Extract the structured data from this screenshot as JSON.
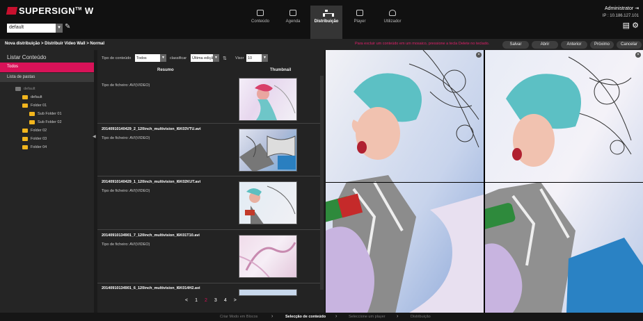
{
  "header": {
    "logo": "SUPERSIGN",
    "logo_tm": "TM",
    "logo_suffix": "W",
    "group_select": "default",
    "nav": [
      {
        "label": "Conteúdo",
        "icon": "content-icon"
      },
      {
        "label": "Agenda",
        "icon": "calendar-icon"
      },
      {
        "label": "Distribuição",
        "icon": "distribution-icon",
        "active": true
      },
      {
        "label": "Player",
        "icon": "player-icon"
      },
      {
        "label": "Utilizador",
        "icon": "user-icon"
      }
    ],
    "user": "Administrator",
    "ip": "IP : 10.186.127.101"
  },
  "toolbar": {
    "breadcrumb": "Nova distribuição > Distribuir Video Wall > Normal",
    "hint": "Para excluir um conteúdo em um mosaico, pressione a tecla Delete no teclado.",
    "buttons": [
      "Salvar",
      "Abrir",
      "Anterior",
      "Próximo",
      "Cancelar"
    ]
  },
  "sidebar": {
    "title": "Listar Conteúdo",
    "tab_all": "Todos",
    "tab_folders": "Lista de pastas",
    "tree": [
      {
        "label": "default",
        "level": 0,
        "root": true
      },
      {
        "label": "default",
        "level": 1
      },
      {
        "label": "Folder 01",
        "level": 1
      },
      {
        "label": "Sub Folder 01",
        "level": 2
      },
      {
        "label": "Sub Folder 02",
        "level": 2
      },
      {
        "label": "Folder 02",
        "level": 1
      },
      {
        "label": "Folder 03",
        "level": 1
      },
      {
        "label": "Folder 04",
        "level": 1
      }
    ]
  },
  "list": {
    "filter_type_label": "Tipo de conteúdo",
    "filter_type_value": "Todos",
    "sort_label": "classificar",
    "sort_value": "Última ediçã",
    "view_label": "Visor",
    "view_value": "10",
    "col_summary": "Resumo",
    "col_thumb": "Thumbnail",
    "items": [
      {
        "name": "",
        "type": "Tipo de ficheiro: AVI(VIDEO)"
      },
      {
        "name": "20140910140429_2_120inch_multivision_I6K03VTU.avi",
        "type": "Tipo de ficheiro: AVI(VIDEO)"
      },
      {
        "name": "20140910140429_1_120inch_multivision_I6K02KUT.avi",
        "type": "Tipo de ficheiro: AVI(VIDEO)"
      },
      {
        "name": "20140910134901_7_120inch_multivision_I6K01T10.avi",
        "type": "Tipo de ficheiro: AVI(VIDEO)"
      },
      {
        "name": "20140910134901_6_120inch_multivision_I6K014H2.avi",
        "type": ""
      }
    ],
    "pages": [
      "<",
      "1",
      "2",
      "3",
      "4",
      ">"
    ],
    "current_page": "2"
  },
  "footer": {
    "steps": [
      "Criar Modo em Blocos",
      "Selecção de conteúdo",
      "Seleccione um player",
      "Distribuição"
    ],
    "current_step": "Selecção de conteúdo"
  },
  "colors": {
    "accent": "#d81258",
    "folder": "#f2b51d"
  }
}
